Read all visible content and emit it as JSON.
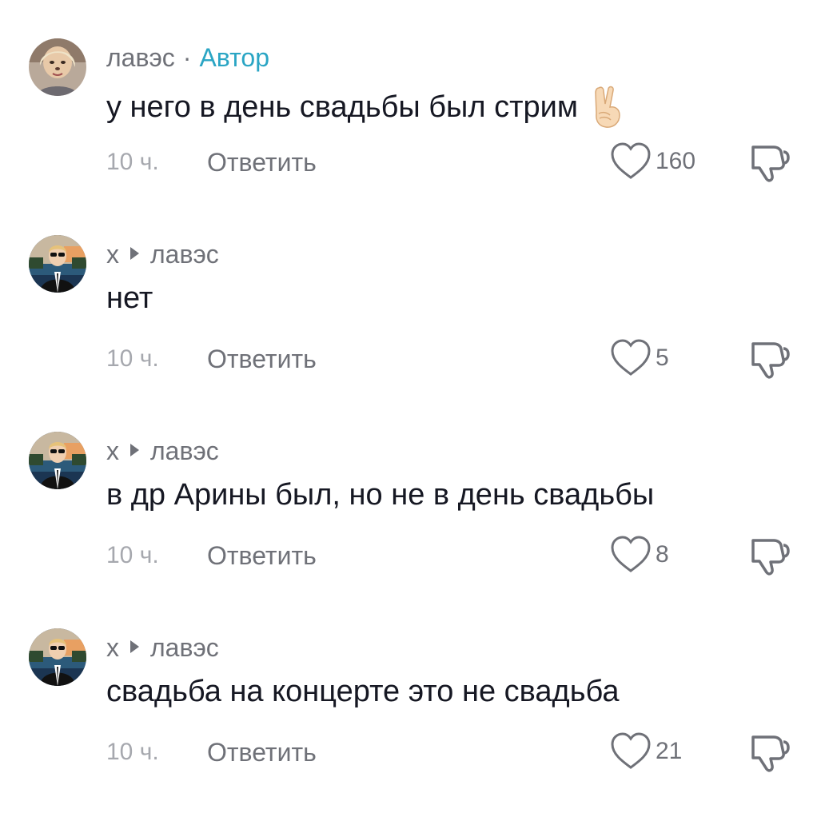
{
  "comments": [
    {
      "username": "лавэс",
      "separator": "·",
      "author_badge": "Автор",
      "text": "у него в день свадьбы был стрим",
      "emoji": "victory-hand-emoji",
      "time": "10 ч.",
      "reply_label": "Ответить",
      "likes": "160",
      "avatar": "girl-avatar"
    },
    {
      "username": "х",
      "reply_to": "лавэс",
      "text": "нет",
      "time": "10 ч.",
      "reply_label": "Ответить",
      "likes": "5",
      "avatar": "man-sunglasses-avatar"
    },
    {
      "username": "х",
      "reply_to": "лавэс",
      "text": "в др Арины был, но не в день свадьбы",
      "time": "10 ч.",
      "reply_label": "Ответить",
      "likes": "8",
      "avatar": "man-sunglasses-avatar"
    },
    {
      "username": "х",
      "reply_to": "лавэс",
      "text": "свадьба на концерте это не свадьба",
      "time": "10 ч.",
      "reply_label": "Ответить",
      "likes": "21",
      "avatar": "man-sunglasses-avatar"
    }
  ],
  "colors": {
    "author_accent": "#2aa5c4",
    "secondary_text": "#6f7178",
    "muted_text": "#a6a8ae",
    "primary_text": "#161823"
  }
}
